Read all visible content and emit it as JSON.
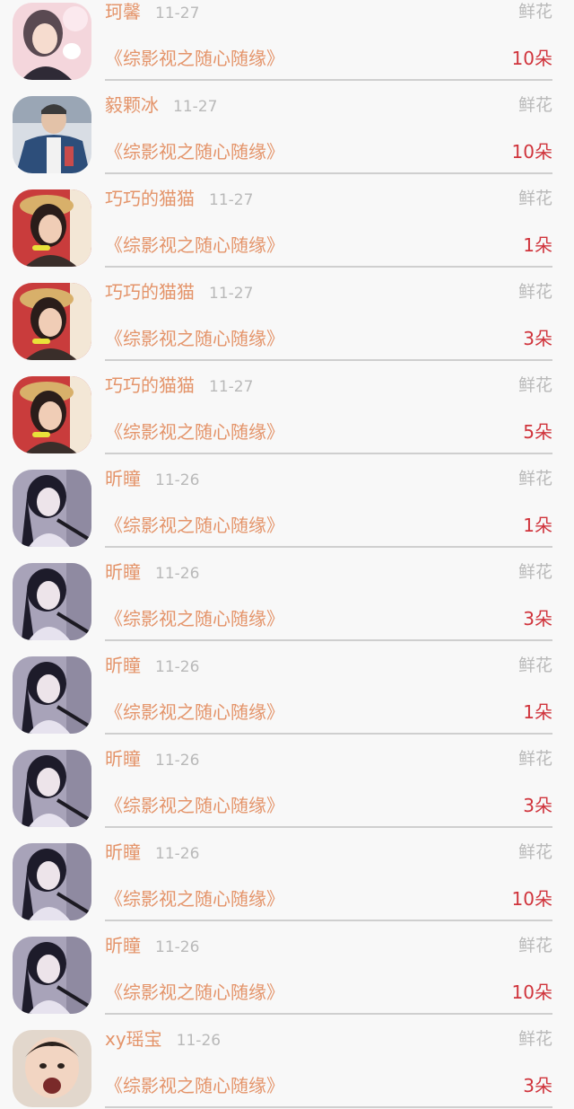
{
  "gift_label": "鲜花",
  "book_title": "《综影视之随心随缘》",
  "rows": [
    {
      "name": "珂馨",
      "date": "11-27",
      "count": "10朵",
      "avatar": "avatar-pink-illustration"
    },
    {
      "name": "毅颗冰",
      "date": "11-27",
      "count": "10朵",
      "avatar": "avatar-man-denim"
    },
    {
      "name": "巧巧的猫猫",
      "date": "11-27",
      "count": "1朵",
      "avatar": "avatar-woman-straw-hat"
    },
    {
      "name": "巧巧的猫猫",
      "date": "11-27",
      "count": "3朵",
      "avatar": "avatar-woman-straw-hat"
    },
    {
      "name": "巧巧的猫猫",
      "date": "11-27",
      "count": "5朵",
      "avatar": "avatar-woman-straw-hat"
    },
    {
      "name": "昕瞳",
      "date": "11-26",
      "count": "1朵",
      "avatar": "avatar-anime-girl"
    },
    {
      "name": "昕瞳",
      "date": "11-26",
      "count": "3朵",
      "avatar": "avatar-anime-girl"
    },
    {
      "name": "昕瞳",
      "date": "11-26",
      "count": "1朵",
      "avatar": "avatar-anime-girl"
    },
    {
      "name": "昕瞳",
      "date": "11-26",
      "count": "3朵",
      "avatar": "avatar-anime-girl"
    },
    {
      "name": "昕瞳",
      "date": "11-26",
      "count": "10朵",
      "avatar": "avatar-anime-girl"
    },
    {
      "name": "昕瞳",
      "date": "11-26",
      "count": "10朵",
      "avatar": "avatar-anime-girl"
    },
    {
      "name": "xy瑶宝",
      "date": "11-26",
      "count": "3朵",
      "avatar": "avatar-child"
    }
  ]
}
